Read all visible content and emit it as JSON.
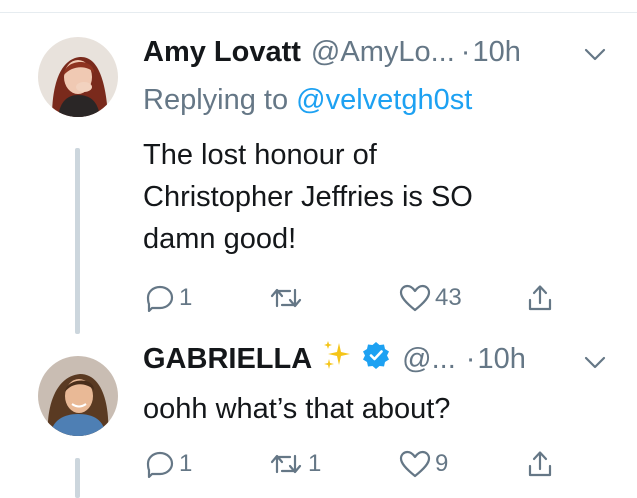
{
  "tweets": [
    {
      "name": "Amy Lovatt",
      "handle": "@AmyLo...",
      "sep": "·",
      "time": "10h",
      "replying_prefix": "Replying to ",
      "replying_handle": "@velvetgh0st",
      "text_lines": [
        "The lost honour of",
        "Christopher Jeffries is SO",
        "damn good!"
      ],
      "reply_count": "1",
      "retweet_count": "",
      "like_count": "43"
    },
    {
      "name": "GABRIELLA",
      "handle": "@...",
      "sep": "·",
      "time": "10h",
      "text_lines": [
        "oohh what’s that about?"
      ],
      "reply_count": "1",
      "retweet_count": "1",
      "like_count": "9"
    }
  ],
  "icons": {
    "reply": "reply-icon",
    "retweet": "retweet-icon",
    "like": "heart-icon",
    "share": "share-icon",
    "more": "chevron-down-icon",
    "verified": "verified-badge-icon",
    "sparkles": "sparkles-icon"
  },
  "colors": {
    "link": "#1da1f2",
    "muted": "#657786",
    "text": "#14171a",
    "thread_line": "#ccd6dd",
    "sparkle": "#f5c518"
  }
}
